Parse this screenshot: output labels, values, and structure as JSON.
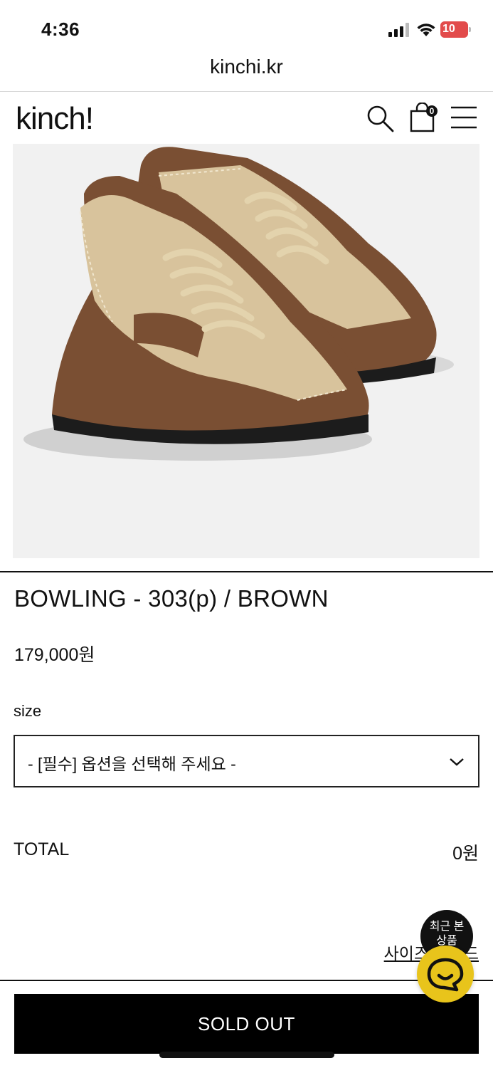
{
  "status_bar": {
    "time": "4:36",
    "battery": "10"
  },
  "browser": {
    "url": "kinchi.kr"
  },
  "header": {
    "logo": "kinch!",
    "cart_count": "0"
  },
  "product": {
    "title": "BOWLING - 303(p) / BROWN",
    "price": "179,000원",
    "option_label": "size",
    "option_placeholder": "- [필수] 옵션을 선택해 주세요 -",
    "total_label": "TOTAL",
    "total_value": "0원",
    "size_guide": "사이즈 가이드",
    "sold_out": "SOLD OUT"
  },
  "floating": {
    "recent_label_line1": "최근 본",
    "recent_label_line2": "상품"
  },
  "colors": {
    "accent": "#000000",
    "chat_button": "#e8c41b",
    "battery": "#e24b4b"
  }
}
